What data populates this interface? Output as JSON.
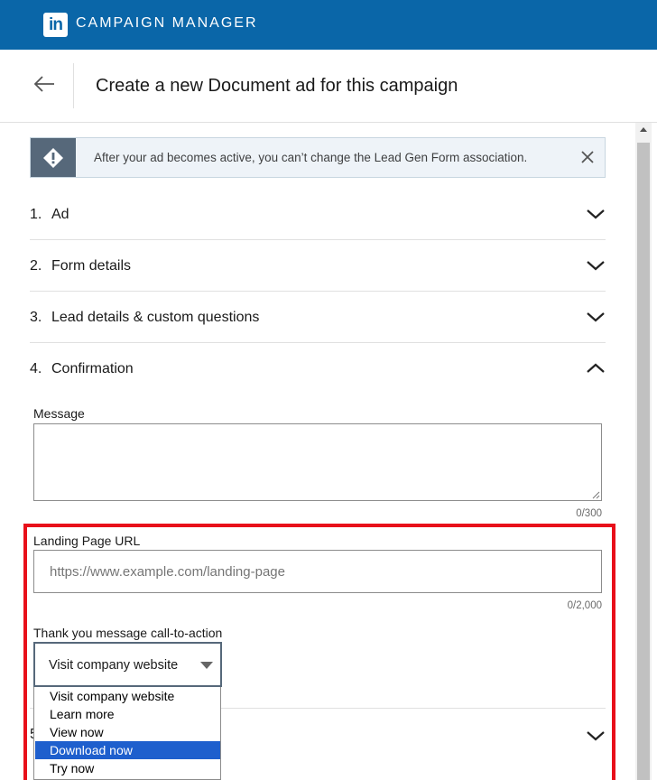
{
  "topbar": {
    "logo_text": "in",
    "app_title": "CAMPAIGN MANAGER",
    "brand_color": "#0a66a8"
  },
  "header": {
    "back_icon": "arrow-left-icon",
    "title": "Create a new Document ad for this campaign"
  },
  "alert": {
    "icon": "exclamation-diamond-icon",
    "text": "After your ad becomes active, you can’t change the Lead Gen Form association.",
    "close_icon": "close-icon"
  },
  "sections": [
    {
      "num": "1.",
      "label": "Ad",
      "expanded": false
    },
    {
      "num": "2.",
      "label": "Form details",
      "expanded": false
    },
    {
      "num": "3.",
      "label": "Lead details & custom questions",
      "expanded": false
    },
    {
      "num": "4.",
      "label": "Confirmation",
      "expanded": true
    },
    {
      "num": "5",
      "label": "",
      "expanded": false
    }
  ],
  "confirmation": {
    "message_label": "Message",
    "message_value": "",
    "message_counter": "0/300",
    "landing_label": "Landing Page URL",
    "landing_placeholder": "https://www.example.com/landing-page",
    "landing_counter": "0/2,000",
    "cta_label": "Thank you message call-to-action",
    "cta_value": "Visit company website",
    "cta_options": [
      "Visit company website",
      "Learn more",
      "View now",
      "Download now",
      "Try now"
    ],
    "cta_highlighted": "Download now"
  },
  "colors": {
    "highlight_border": "#e8101a",
    "option_selected": "#1e5fcd",
    "alert_icon_bg": "#56687a"
  }
}
